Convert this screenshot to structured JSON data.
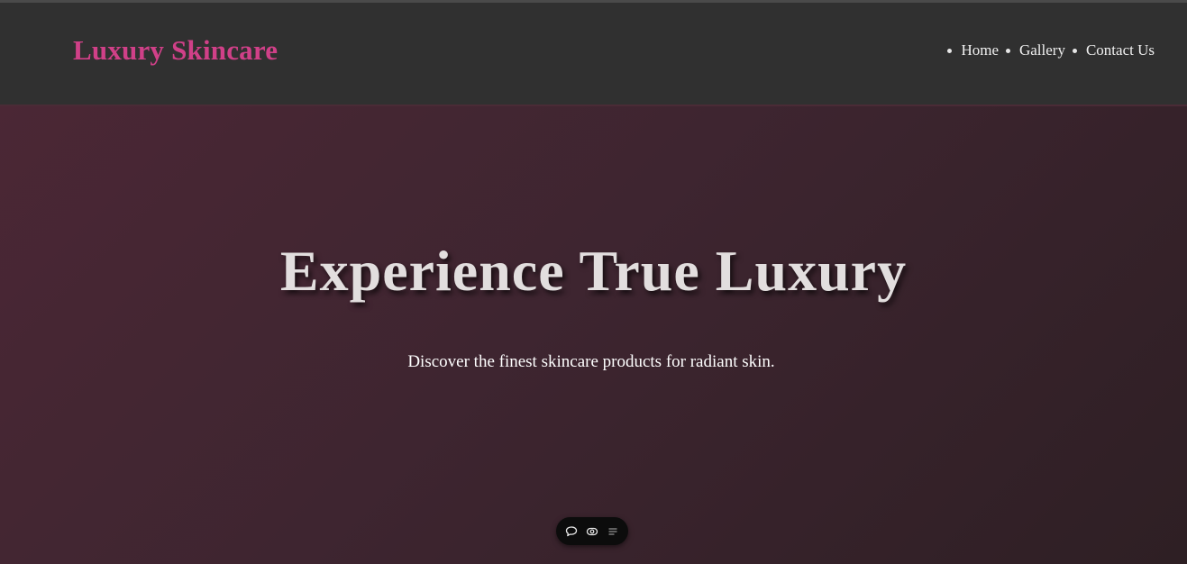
{
  "header": {
    "brand": "Luxury Skincare",
    "nav": [
      {
        "label": "Home"
      },
      {
        "label": "Gallery"
      },
      {
        "label": "Contact Us"
      }
    ]
  },
  "hero": {
    "title": "Experience True Luxury",
    "subtitle": "Discover the finest skincare products for radiant skin."
  },
  "toolbar": {
    "icons": [
      "comment-icon",
      "eye-icon",
      "menu-icon"
    ]
  },
  "colors": {
    "brand": "#d04088",
    "header_bg": "#303030",
    "hero_gradient_start": "#4b2735",
    "hero_gradient_end": "#2e1f24",
    "title_text": "#e2dede"
  }
}
